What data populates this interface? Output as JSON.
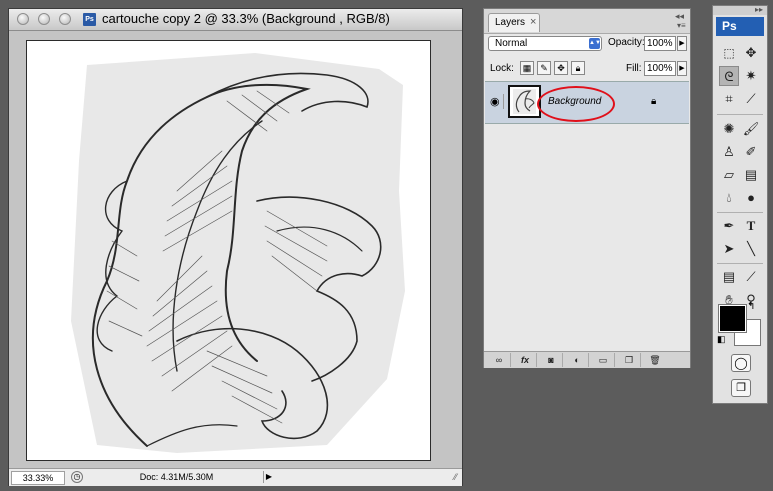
{
  "document": {
    "title": "cartouche copy 2 @ 33.3% (Background , RGB/8)",
    "doc_icon": "Ps",
    "status": {
      "zoom": "33.33%",
      "doc_size": "Doc: 4.31M/5.30M"
    }
  },
  "layers_panel": {
    "tab_label": "Layers",
    "tab_close": "×",
    "blend_mode": "Normal",
    "opacity_label": "Opacity:",
    "opacity_value": "100%",
    "lock_label": "Lock:",
    "fill_label": "Fill:",
    "fill_value": "100%",
    "layers": [
      {
        "name": "Background",
        "visible": true,
        "locked": true
      }
    ],
    "bottom_buttons": [
      "link-icon",
      "fx-icon",
      "mask-icon",
      "adjustment-icon",
      "folder-icon",
      "new-layer-icon",
      "trash-icon"
    ]
  },
  "tools_panel": {
    "logo": "Ps",
    "foreground_color": "#000000",
    "background_color": "#ffffff"
  },
  "colors": {
    "annotation_ellipse": "#e0101a",
    "selected_layer_row": "#c9d3e0"
  }
}
